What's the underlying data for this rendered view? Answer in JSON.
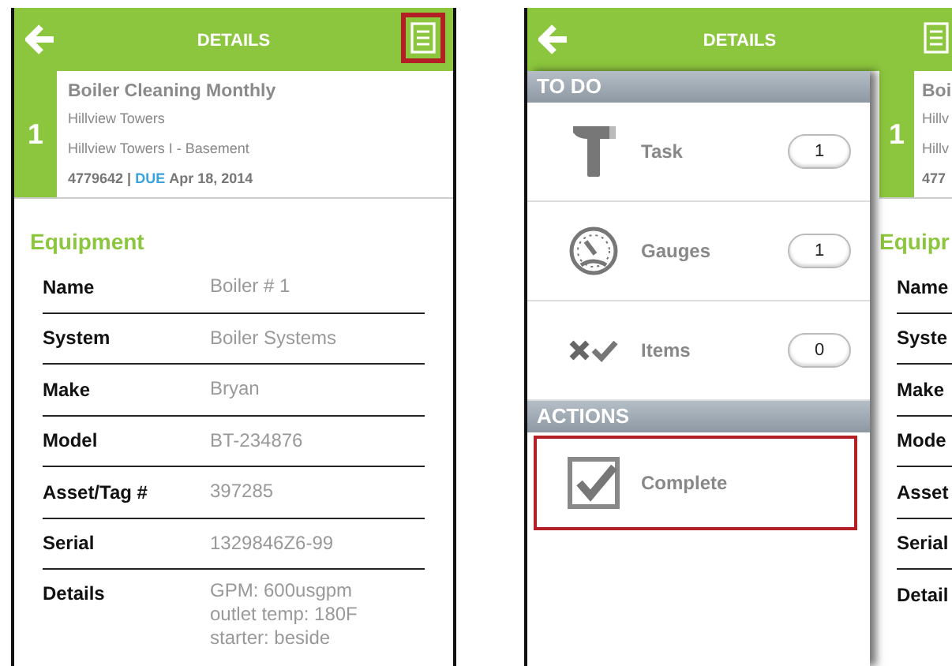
{
  "screens": [
    {
      "header": {
        "title": "DETAILS",
        "menu_highlighted": true
      },
      "task": {
        "number": "1",
        "title": "Boiler Cleaning Monthly",
        "site": "Hillview Towers",
        "location": "Hillview Towers I - Basement",
        "id": "4779642 |",
        "due_label": "DUE",
        "due_date": "Apr 18, 2014"
      },
      "section_title": "Equipment",
      "fields": [
        {
          "label": "Name",
          "value": "Boiler # 1"
        },
        {
          "label": "System",
          "value": "Boiler Systems"
        },
        {
          "label": "Make",
          "value": "Bryan"
        },
        {
          "label": "Model",
          "value": "BT-234876"
        },
        {
          "label": "Asset/Tag #",
          "value": "397285"
        },
        {
          "label": "Serial",
          "value": "1329846Z6-99"
        },
        {
          "label": "Details",
          "value": "GPM: 600usgpm\noutlet temp: 180F\nstarter: beside"
        }
      ]
    },
    {
      "header": {
        "title": "DETAILS",
        "menu_highlighted": false
      },
      "drawer": {
        "sections": [
          {
            "title": "TO DO",
            "items": [
              {
                "kind": "task",
                "label": "Task",
                "count": "1",
                "highlighted": false
              },
              {
                "kind": "gauges",
                "label": "Gauges",
                "count": "1",
                "highlighted": false
              },
              {
                "kind": "items",
                "label": "Items",
                "count": "0",
                "highlighted": false
              }
            ]
          },
          {
            "title": "ACTIONS",
            "items": [
              {
                "kind": "complete",
                "label": "Complete",
                "highlighted": true
              }
            ]
          }
        ]
      },
      "peek": {
        "number": "1",
        "title": "Boi",
        "site": "Hillv",
        "location": "Hillv",
        "id": "477",
        "section_title": "Equipr",
        "labels": [
          "Name",
          "Syste",
          "Make",
          "Mode",
          "Asset",
          "Serial",
          "Detail"
        ]
      }
    }
  ]
}
